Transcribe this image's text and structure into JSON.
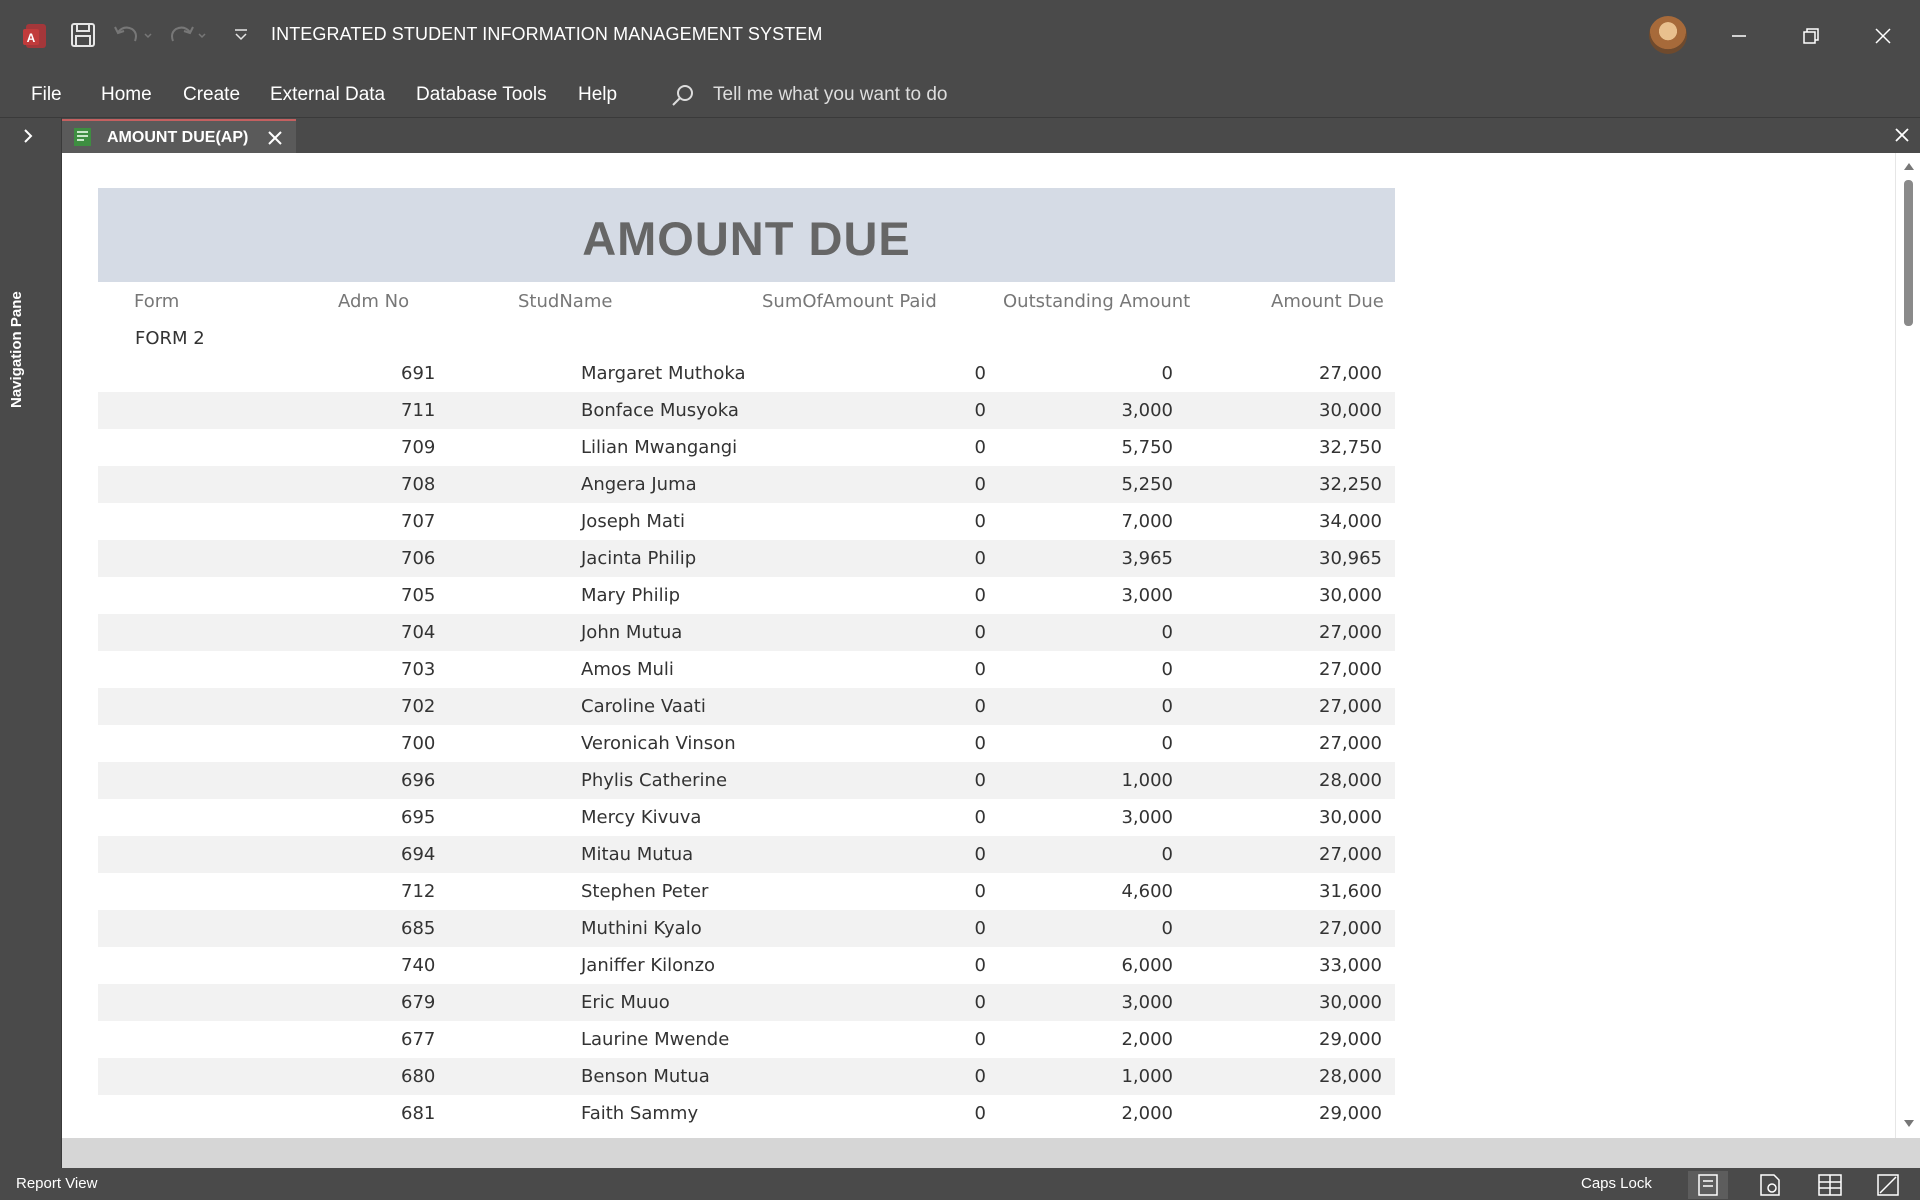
{
  "window": {
    "title": "INTEGRATED STUDENT INFORMATION MANAGEMENT SYSTEM"
  },
  "ribbon": {
    "tabs": [
      "File",
      "Home",
      "Create",
      "External Data",
      "Database Tools",
      "Help"
    ],
    "search_text": "Tell me what you want to do"
  },
  "nav_pane": {
    "label": "Navigation Pane"
  },
  "document_tab": {
    "label": "AMOUNT DUE(AP)"
  },
  "report": {
    "title": "AMOUNT DUE",
    "columns": [
      "Form",
      "Adm No",
      "StudName",
      "SumOfAmount Paid",
      "Outstanding Amount",
      "Amount Due"
    ],
    "group": "FORM 2",
    "rows": [
      {
        "adm": "691",
        "name": "Margaret Muthoka",
        "paid": "0",
        "outstanding": "0",
        "due": "27,000"
      },
      {
        "adm": "711",
        "name": "Bonface Musyoka",
        "paid": "0",
        "outstanding": "3,000",
        "due": "30,000"
      },
      {
        "adm": "709",
        "name": "Lilian Mwangangi",
        "paid": "0",
        "outstanding": "5,750",
        "due": "32,750"
      },
      {
        "adm": "708",
        "name": "Angera Juma",
        "paid": "0",
        "outstanding": "5,250",
        "due": "32,250"
      },
      {
        "adm": "707",
        "name": "Joseph Mati",
        "paid": "0",
        "outstanding": "7,000",
        "due": "34,000"
      },
      {
        "adm": "706",
        "name": "Jacinta Philip",
        "paid": "0",
        "outstanding": "3,965",
        "due": "30,965"
      },
      {
        "adm": "705",
        "name": "Mary Philip",
        "paid": "0",
        "outstanding": "3,000",
        "due": "30,000"
      },
      {
        "adm": "704",
        "name": "John Mutua",
        "paid": "0",
        "outstanding": "0",
        "due": "27,000"
      },
      {
        "adm": "703",
        "name": "Amos Muli",
        "paid": "0",
        "outstanding": "0",
        "due": "27,000"
      },
      {
        "adm": "702",
        "name": "Caroline Vaati",
        "paid": "0",
        "outstanding": "0",
        "due": "27,000"
      },
      {
        "adm": "700",
        "name": "Veronicah Vinson",
        "paid": "0",
        "outstanding": "0",
        "due": "27,000"
      },
      {
        "adm": "696",
        "name": "Phylis Catherine",
        "paid": "0",
        "outstanding": "1,000",
        "due": "28,000"
      },
      {
        "adm": "695",
        "name": "Mercy Kivuva",
        "paid": "0",
        "outstanding": "3,000",
        "due": "30,000"
      },
      {
        "adm": "694",
        "name": "Mitau Mutua",
        "paid": "0",
        "outstanding": "0",
        "due": "27,000"
      },
      {
        "adm": "712",
        "name": "Stephen Peter",
        "paid": "0",
        "outstanding": "4,600",
        "due": "31,600"
      },
      {
        "adm": "685",
        "name": "Muthini Kyalo",
        "paid": "0",
        "outstanding": "0",
        "due": "27,000"
      },
      {
        "adm": "740",
        "name": "Janiffer Kilonzo",
        "paid": "0",
        "outstanding": "6,000",
        "due": "33,000"
      },
      {
        "adm": "679",
        "name": "Eric Muuo",
        "paid": "0",
        "outstanding": "3,000",
        "due": "30,000"
      },
      {
        "adm": "677",
        "name": "Laurine Mwende",
        "paid": "0",
        "outstanding": "2,000",
        "due": "29,000"
      },
      {
        "adm": "680",
        "name": "Benson Mutua",
        "paid": "0",
        "outstanding": "1,000",
        "due": "28,000"
      },
      {
        "adm": "681",
        "name": "Faith Sammy",
        "paid": "0",
        "outstanding": "2,000",
        "due": "29,000"
      }
    ]
  },
  "status_bar": {
    "left": "Report View",
    "caps_lock": "Caps Lock"
  },
  "colors": {
    "chrome": "#4a4a4a",
    "header_band": "#d5dbe5",
    "alt_row": "#f2f2f2",
    "access_red": "#c13b3b"
  },
  "icons": {
    "app": "access-app-icon",
    "save": "save-icon",
    "undo": "undo-icon",
    "redo": "redo-icon",
    "search": "search-icon",
    "report": "report-icon"
  }
}
